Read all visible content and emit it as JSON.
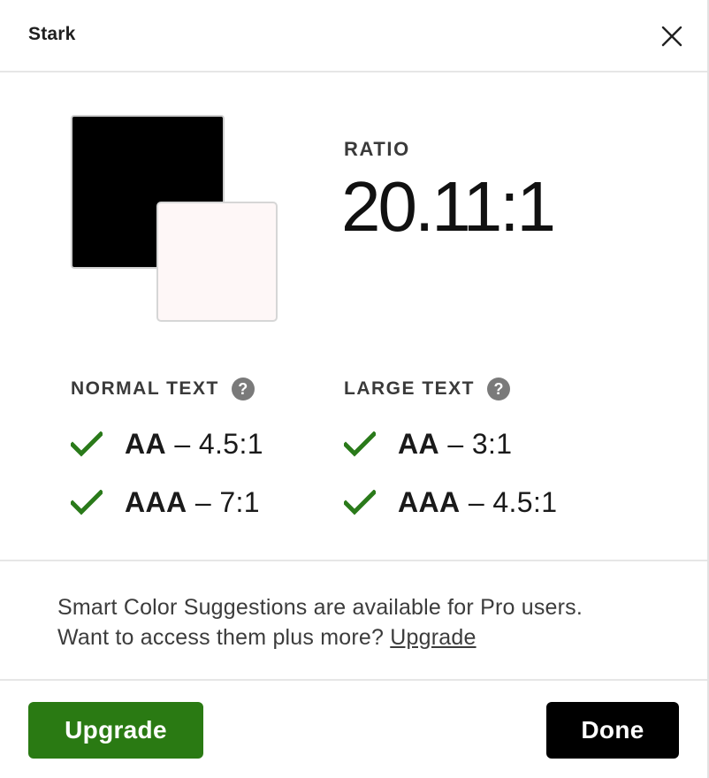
{
  "window": {
    "title": "Stark",
    "close_icon": "close-icon"
  },
  "swatches": {
    "foreground_color": "#000000",
    "background_color": "#fef7f7"
  },
  "ratio": {
    "label": "RATIO",
    "value": "20.11:1"
  },
  "normal_text": {
    "heading": "NORMAL TEXT",
    "help_icon": "?",
    "checks": [
      {
        "level": "AA",
        "separator": " – ",
        "threshold": "4.5:1",
        "status": "pass"
      },
      {
        "level": "AAA",
        "separator": " – ",
        "threshold": "7:1",
        "status": "pass"
      }
    ]
  },
  "large_text": {
    "heading": "LARGE TEXT",
    "help_icon": "?",
    "checks": [
      {
        "level": "AA",
        "separator": " – ",
        "threshold": "3:1",
        "status": "pass"
      },
      {
        "level": "AAA",
        "separator": " – ",
        "threshold": "4.5:1",
        "status": "pass"
      }
    ]
  },
  "promo": {
    "line1": "Smart Color Suggestions are available for Pro users.",
    "line2": "Want to access them plus more? ",
    "link": "Upgrade"
  },
  "footer": {
    "upgrade_label": "Upgrade",
    "done_label": "Done"
  },
  "colors": {
    "pass_check": "#2a7a1a",
    "upgrade_button": "#2a7a13",
    "done_button": "#000000",
    "help_icon": "#7a7a7a"
  }
}
